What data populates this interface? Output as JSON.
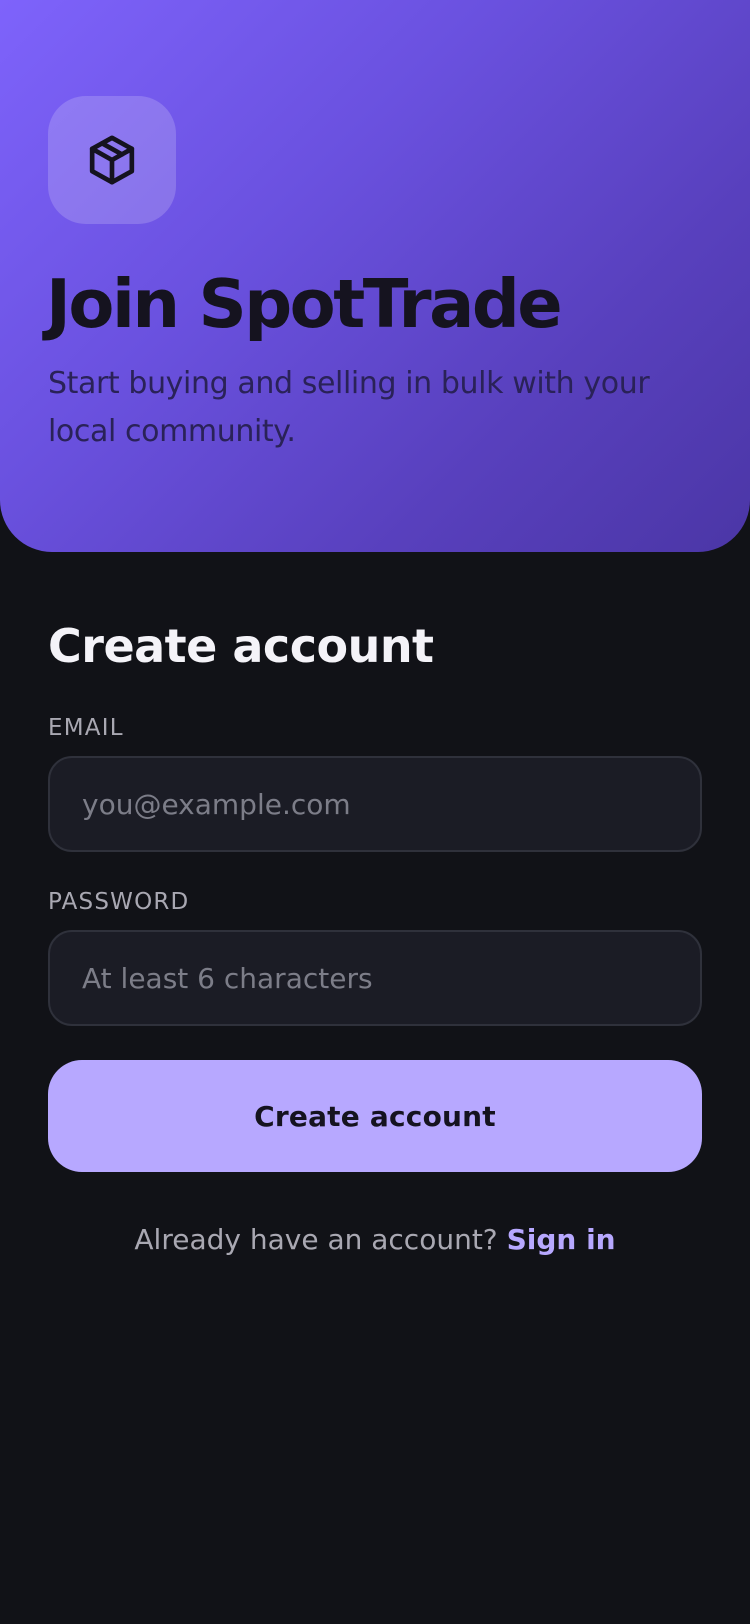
{
  "hero": {
    "logo_icon": "box-icon",
    "title": "Join SpotTrade",
    "subtitle": "Start buying and selling in bulk with your local community."
  },
  "form": {
    "title": "Create account",
    "email": {
      "label": "EMAIL",
      "value": "",
      "placeholder": "you@example.com"
    },
    "password": {
      "label": "PASSWORD",
      "value": "",
      "placeholder": "At least 6 characters"
    },
    "submit_label": "Create account"
  },
  "footer": {
    "prompt": "Already have an account?",
    "link_label": "Sign in"
  },
  "colors": {
    "background": "#111217",
    "hero_gradient_start": "#7e63fb",
    "hero_gradient_end": "#4b36a6",
    "accent": "#b7a8ff",
    "input_background": "#1b1c25",
    "input_border": "#2f313b"
  }
}
